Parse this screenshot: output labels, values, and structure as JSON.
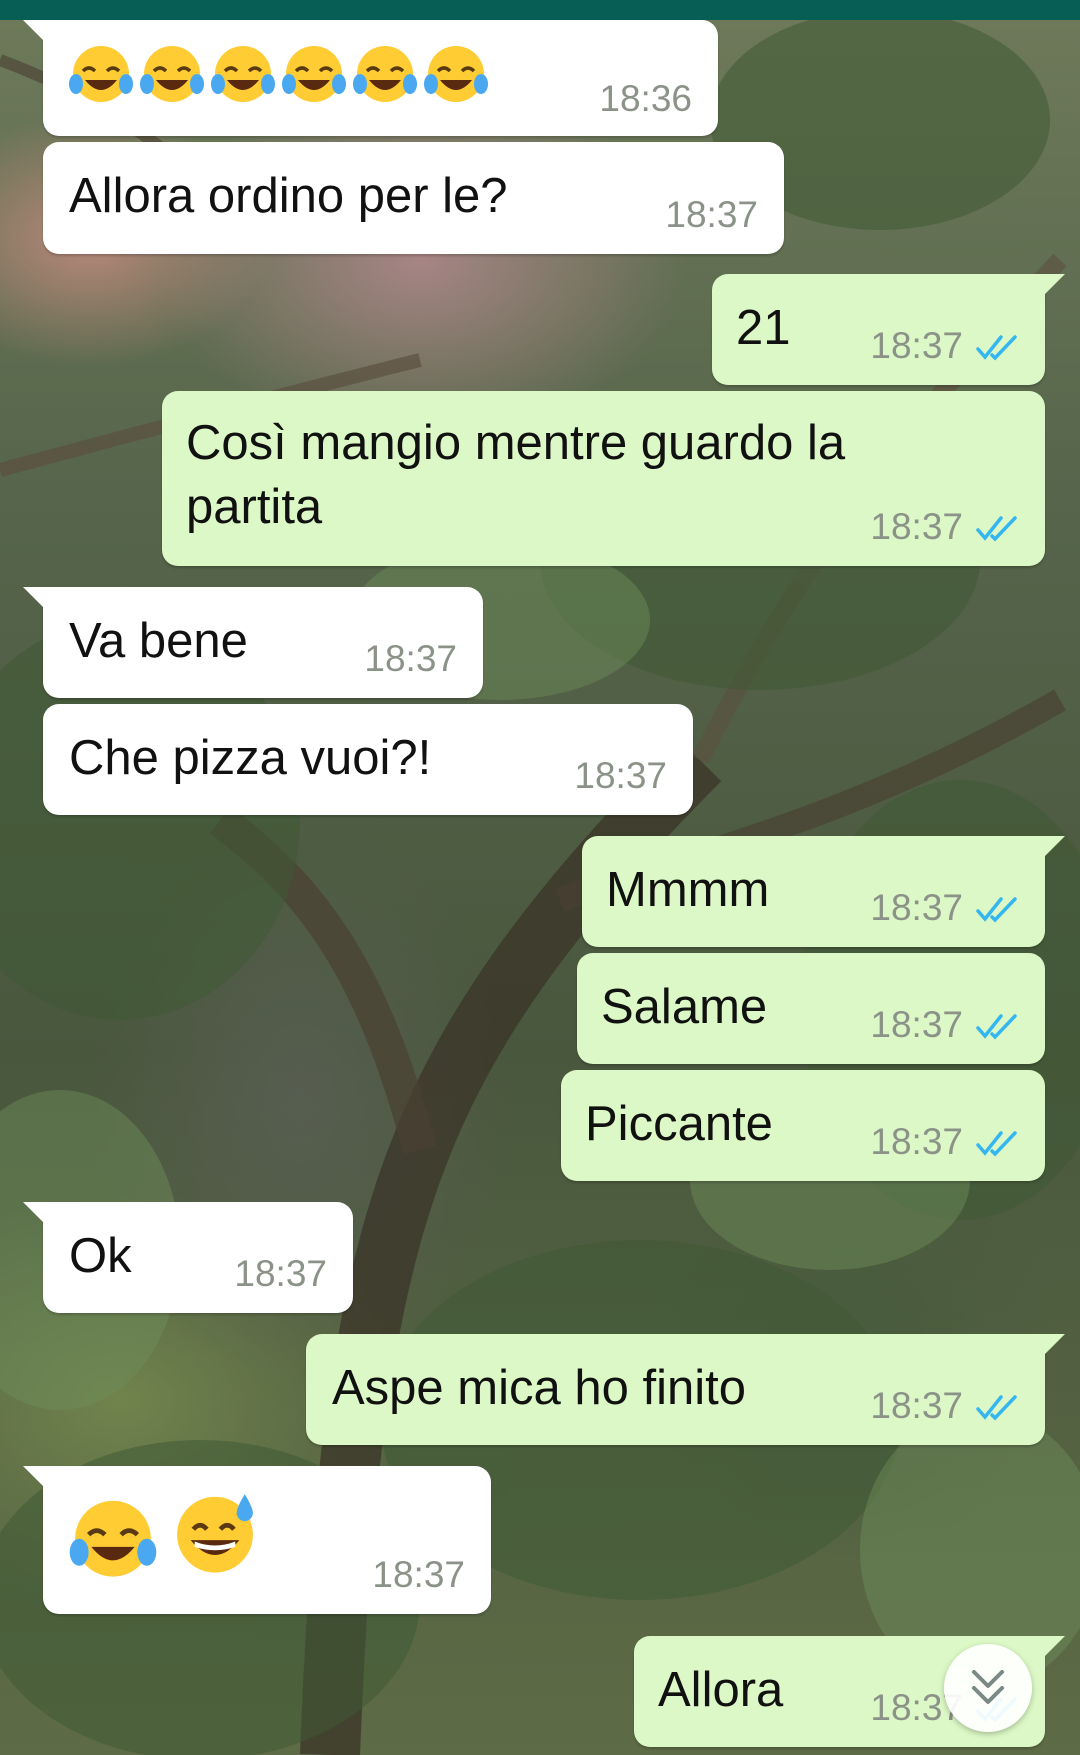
{
  "colors": {
    "header": "#075e54",
    "incoming_bubble": "#ffffff",
    "outgoing_bubble": "#dcf8c6",
    "read_ticks": "#34b7f1",
    "timestamp": "#8b9288"
  },
  "messages": [
    {
      "direction": "incoming",
      "text": "",
      "emojis": [
        "face-with-tears-of-joy",
        "face-with-tears-of-joy",
        "face-with-tears-of-joy",
        "face-with-tears-of-joy",
        "face-with-tears-of-joy",
        "face-with-tears-of-joy"
      ],
      "time": "18:36"
    },
    {
      "direction": "incoming",
      "text": "Allora ordino per le?",
      "time": "18:37"
    },
    {
      "direction": "outgoing",
      "text": "21",
      "time": "18:37",
      "status": "read"
    },
    {
      "direction": "outgoing",
      "text": "Così mangio mentre guardo la\npartita",
      "time": "18:37",
      "status": "read"
    },
    {
      "direction": "incoming",
      "text": "Va bene",
      "time": "18:37"
    },
    {
      "direction": "incoming",
      "text": "Che pizza vuoi?!",
      "time": "18:37"
    },
    {
      "direction": "outgoing",
      "text": "Mmmm",
      "time": "18:37",
      "status": "read"
    },
    {
      "direction": "outgoing",
      "text": "Salame",
      "time": "18:37",
      "status": "read"
    },
    {
      "direction": "outgoing",
      "text": "Piccante",
      "time": "18:37",
      "status": "read"
    },
    {
      "direction": "incoming",
      "text": "Ok",
      "time": "18:37"
    },
    {
      "direction": "outgoing",
      "text": "Aspe mica ho finito",
      "time": "18:37",
      "status": "read"
    },
    {
      "direction": "incoming",
      "text": "",
      "emojis": [
        "face-with-tears-of-joy",
        "grinning-face-with-sweat"
      ],
      "time": "18:37"
    },
    {
      "direction": "outgoing",
      "text": "Allora",
      "time": "18:37",
      "status": "read"
    }
  ],
  "icons": {
    "read_receipt": "double-check-icon",
    "scroll_down": "double-chevron-down-icon"
  }
}
